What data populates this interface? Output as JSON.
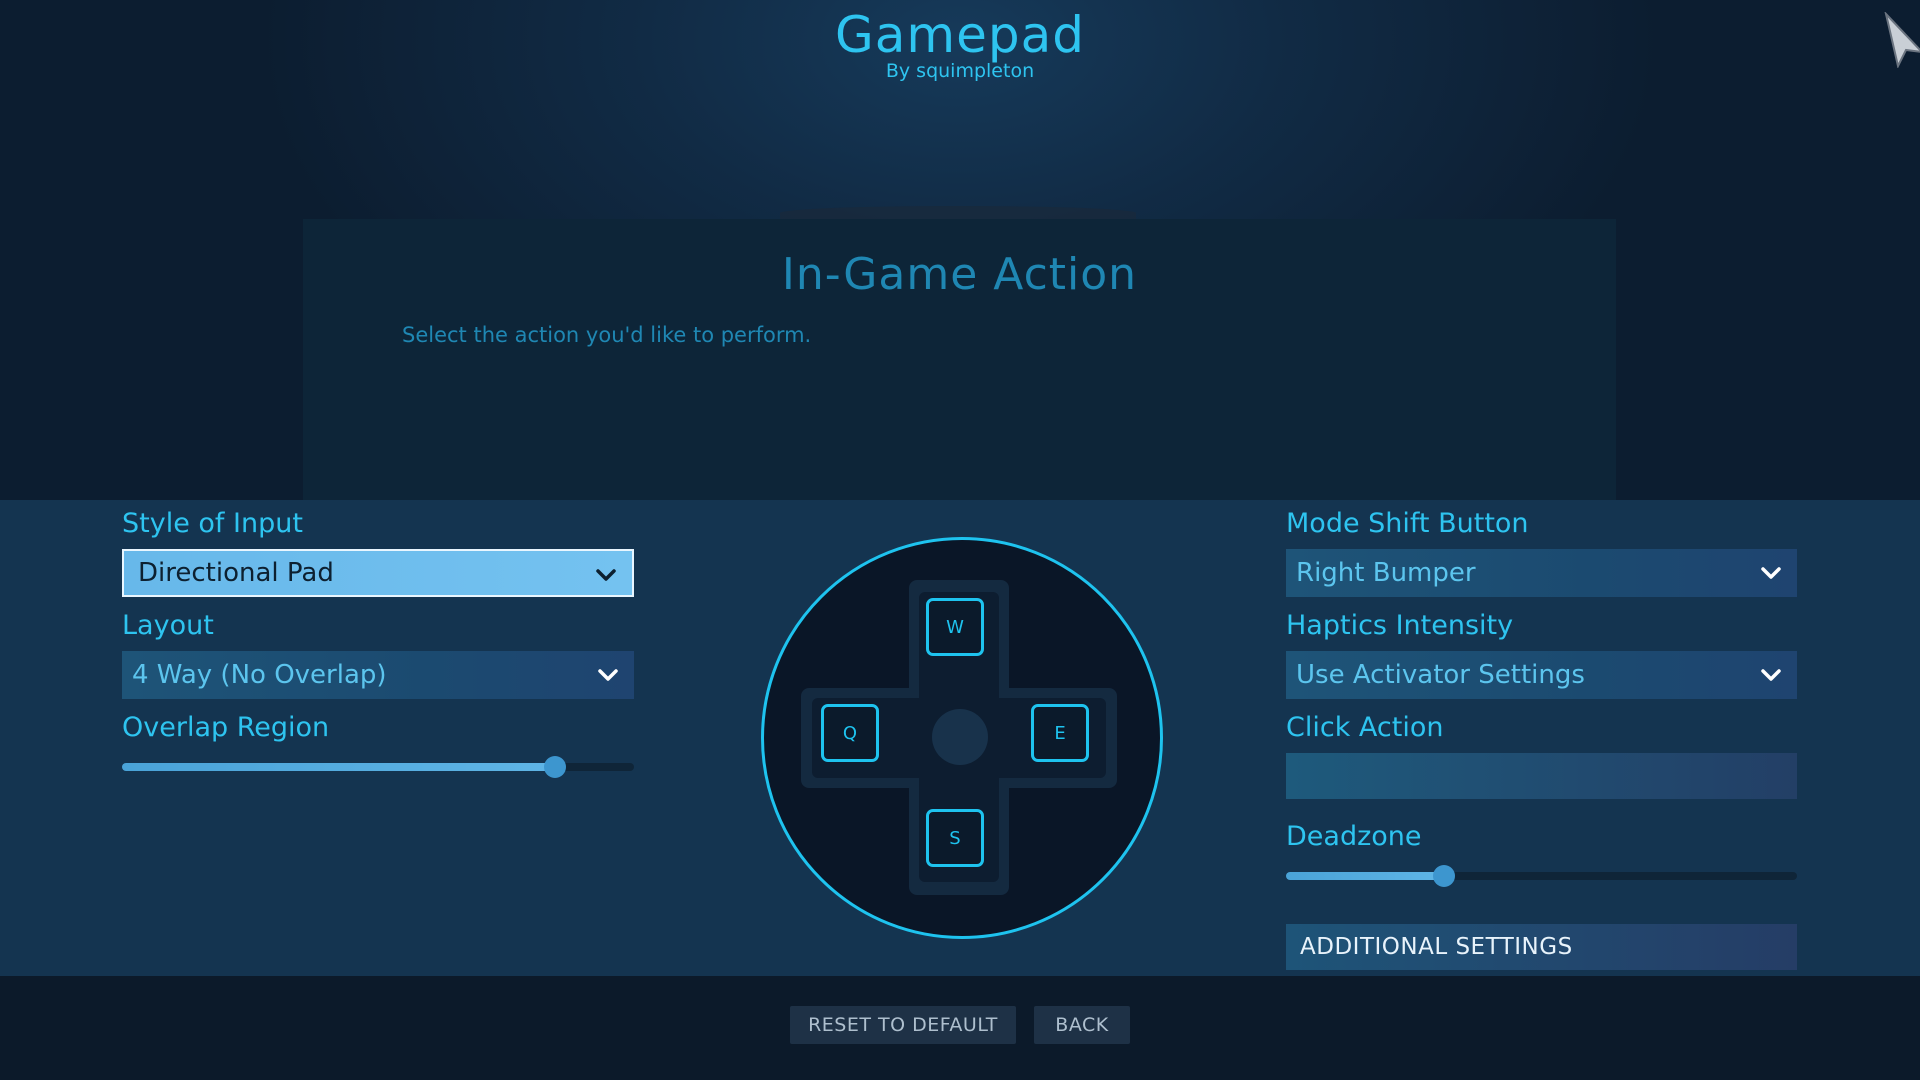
{
  "header": {
    "title": "Gamepad",
    "subtitle": "By squimpleton"
  },
  "action_panel": {
    "title": "In-Game Action",
    "description": "Select the action you'd like to perform."
  },
  "left": {
    "style_label": "Style of Input",
    "style_value": "Directional Pad",
    "layout_label": "Layout",
    "layout_value": "4 Way (No Overlap)",
    "overlap_label": "Overlap Region",
    "overlap_fraction": 0.845
  },
  "dpad": {
    "up": "W",
    "left": "Q",
    "right": "E",
    "down": "S"
  },
  "right": {
    "mode_shift_label": "Mode Shift Button",
    "mode_shift_value": "Right Bumper",
    "haptics_label": "Haptics Intensity",
    "haptics_value": "Use Activator Settings",
    "click_action_label": "Click Action",
    "deadzone_label": "Deadzone",
    "deadzone_fraction": 0.31,
    "additional_settings": "ADDITIONAL SETTINGS"
  },
  "footer": {
    "reset": "RESET TO DEFAULT",
    "back": "BACK"
  },
  "colors": {
    "accent": "#2ec4f0",
    "panel": "#143450",
    "background": "#0c1d30"
  },
  "icons": {
    "dropdown": "chevron-down-icon",
    "cursor": "mouse-pointer-icon"
  }
}
